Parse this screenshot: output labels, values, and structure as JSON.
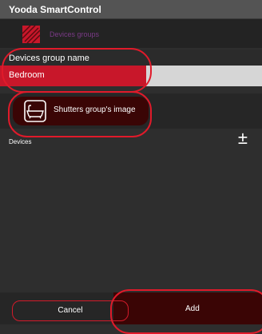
{
  "window": {
    "title": "Yooda SmartControl"
  },
  "header": {
    "label": "Devices groups",
    "logo_icon": "shutter-logo-icon"
  },
  "form": {
    "name_label": "Devices group name",
    "name_value": "Bedroom",
    "image_button_label": "Shutters group's image",
    "image_icon": "bathtub-icon",
    "devices_label": "Devices",
    "add_remove_symbol": "±"
  },
  "footer": {
    "cancel_label": "Cancel",
    "add_label": "Add"
  },
  "colors": {
    "accent_red": "#d21a2a",
    "dark_red": "#3a0505",
    "header_text": "#7a3a86"
  }
}
